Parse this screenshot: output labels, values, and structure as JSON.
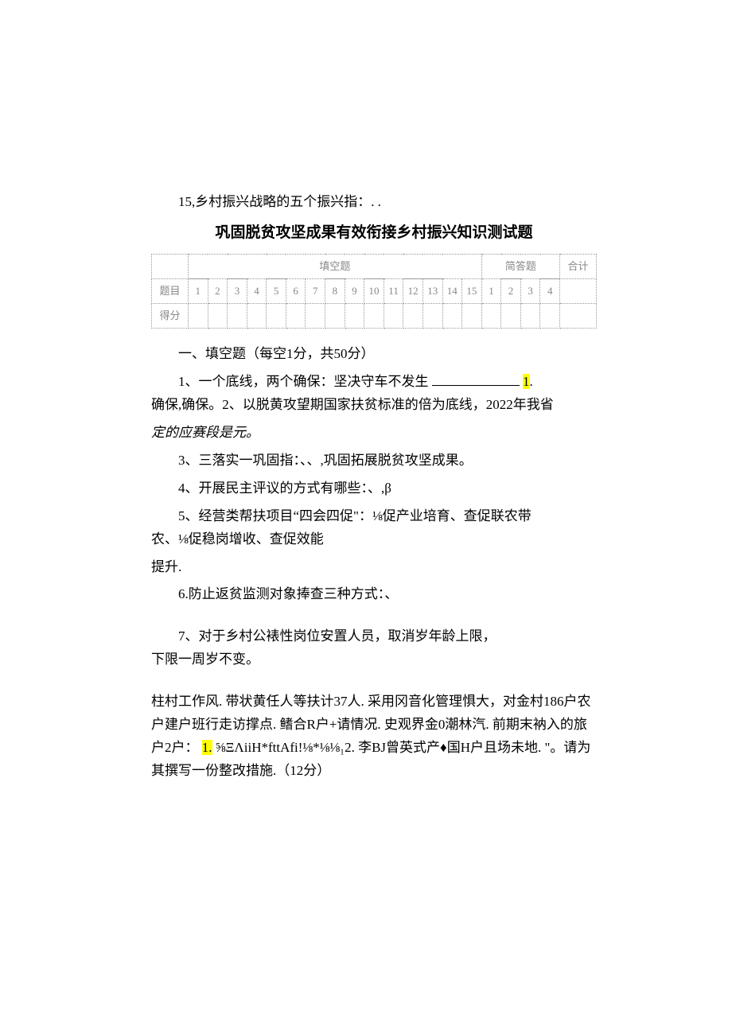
{
  "top_line": "15,乡村振兴战略的五个振兴指：. .",
  "title": "巩固脱贫攻坚成果有效衔接乡村振兴知识测试题",
  "table": {
    "header_fill": "填空题",
    "header_short": "简答题",
    "header_total": "合计",
    "row_topic": "题目",
    "row_score": "得分",
    "fill_nums": [
      "1",
      "2",
      "3",
      "4",
      "5",
      "6",
      "7",
      "8",
      "9",
      "10",
      "11",
      "12",
      "13",
      "14",
      "15"
    ],
    "short_nums": [
      "1",
      "2",
      "3",
      "4"
    ]
  },
  "s1_title": "一、填空题（每空1分，共50分）",
  "q1_a": "1、一个底线，两个确保：坚决守车不发生 ",
  "q1_b": "1",
  "q1_c": ".",
  "q1_d": "确保,确保。2、以脱黄攻望期国家扶贫标准的倍为底线，2022年我省",
  "q1_e": "定的应赛段是元。",
  "q3": "3、三落实一巩固指：、、,巩固拓展脱贫攻坚成果。",
  "q4": "4、开展民主评议的方式有哪些：、,β",
  "q5a": "5、经营类帮扶项目“四会四促\"：⅛促产业培育、查促联农带",
  "q5b": "农、⅛促稳岗增收、查促效能",
  "q5c": "提升.",
  "q6": "6.防止返贫监测对象捧查三种方式：、",
  "q7a": "7、对于乡村公裱性岗位安置人员，取消岁年龄上限，",
  "q7b": "下限一周岁不变。",
  "p1": "柱村工作风. 带状黄任人等扶计37人. 采用冈音化管理惧大，对金村186户农户建户班行走访撑点. 鳍合R户+请情况. 史观界金0潮林汽. 前期末衲入的旅户2户：",
  "p1_hl": "1.",
  "p1b": "⅝ΞΛiiH*fttAfi!⅛*⅛⅛₁2. 李BJ曾英式产♦国H户且场未地. \"。请为其撰写一份整改措施.（12分）"
}
